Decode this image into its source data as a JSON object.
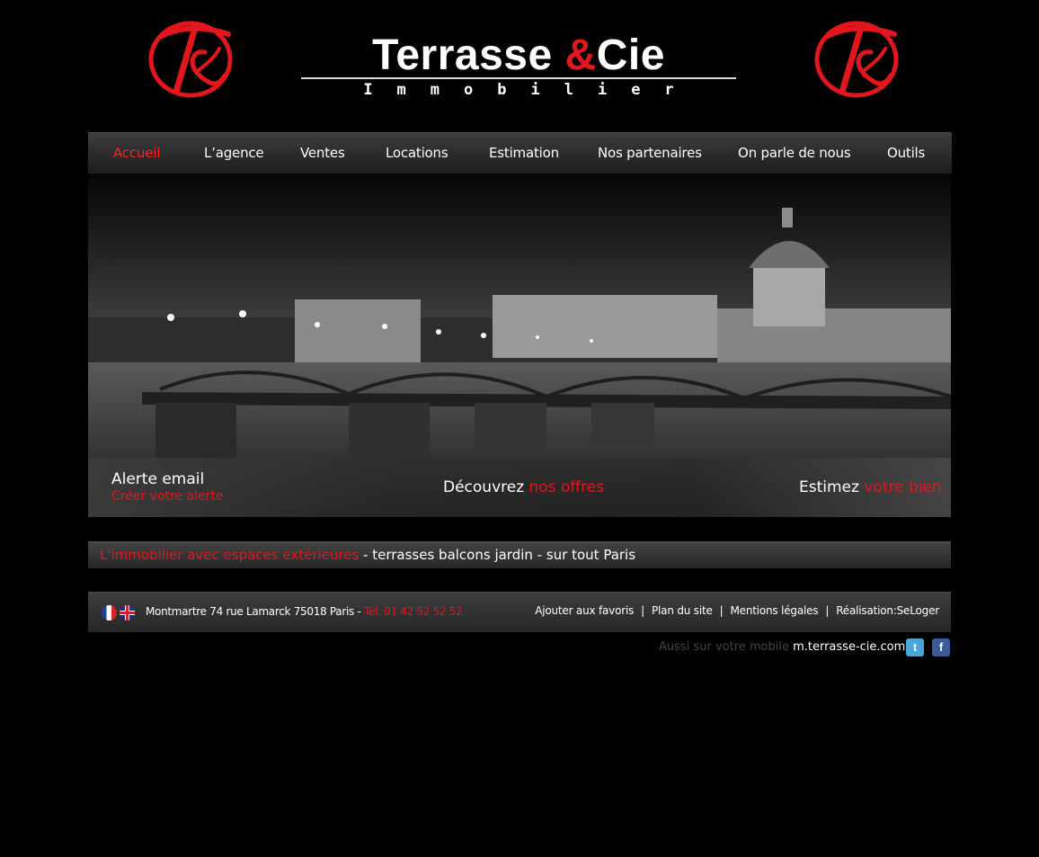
{
  "brand": {
    "title_part1": "Terrasse ",
    "title_amp": "&",
    "title_part2": "Cie",
    "subtitle": "Immobilier",
    "monogram": "T&"
  },
  "nav": {
    "items": [
      {
        "label": "Accueil",
        "active": true
      },
      {
        "label": "L’agence"
      },
      {
        "label": "Ventes"
      },
      {
        "label": "Locations"
      },
      {
        "label": "Estimation"
      },
      {
        "label": "Nos partenaires"
      },
      {
        "label": "On parle de nous"
      },
      {
        "label": "Outils"
      }
    ]
  },
  "hero": {
    "image": "Pont des Arts and Institut de France at night (black and white photo)",
    "alert_title": "Alerte email",
    "alert_link": "Créer votre alerte",
    "offers_prefix": "Découvrez ",
    "offers_link": "nos offres",
    "estimate_prefix": "Estimez ",
    "estimate_link": "votre bien"
  },
  "tagline": {
    "highlight": "L'immobilier avec espaces extérieures",
    "rest": " - terrasses balcons jardin - sur tout Paris"
  },
  "footer": {
    "address": "Montmartre 74 rue Lamarck 75018 Paris - ",
    "phone": "Tél. 01 42 52 52 52",
    "links": [
      "Ajouter aux favoris",
      "Plan du site",
      "Mentions légales",
      "Réalisation:SeLoger"
    ],
    "separator": "|"
  },
  "mobile": {
    "prefix": "Aussi sur votre mobile ",
    "url": "m.terrasse-cie.com"
  },
  "social": {
    "twitter_glyph": "t",
    "facebook_glyph": "f"
  },
  "colors": {
    "accent_red": "#e3161d",
    "background": "#000000"
  }
}
